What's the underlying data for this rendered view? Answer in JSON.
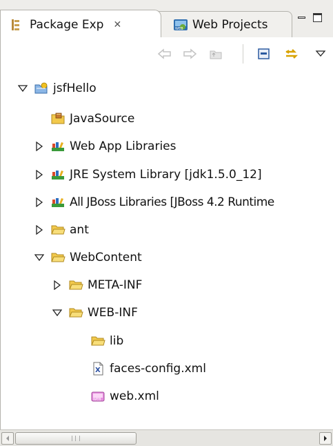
{
  "tabs": {
    "active": {
      "label": "Package Exp",
      "close_glyph": "✕"
    },
    "inactive": {
      "label": "Web Projects"
    }
  },
  "toolbar": {
    "buttons": [
      "back-arrow-icon",
      "forward-arrow-icon",
      "up-folder-icon",
      "collapse-all-icon",
      "link-with-editor-icon",
      "view-menu-icon"
    ]
  },
  "tree": {
    "items": [
      {
        "label": "jsfHello",
        "icon": "project-icon",
        "expanded": true
      },
      {
        "label": "JavaSource",
        "icon": "source-folder-icon",
        "expanded": null
      },
      {
        "label": "Web App Libraries",
        "icon": "library-icon",
        "expanded": false
      },
      {
        "label": "JRE System Library [jdk1.5.0_12]",
        "icon": "library-icon",
        "expanded": false
      },
      {
        "label": "All JBoss Libraries [JBoss 4.2 Runtime",
        "icon": "library-icon",
        "expanded": false
      },
      {
        "label": "ant",
        "icon": "folder-icon",
        "expanded": false
      },
      {
        "label": "WebContent",
        "icon": "folder-icon",
        "expanded": true
      },
      {
        "label": "META-INF",
        "icon": "folder-icon",
        "expanded": false
      },
      {
        "label": "WEB-INF",
        "icon": "folder-icon",
        "expanded": true
      },
      {
        "label": "lib",
        "icon": "folder-icon",
        "expanded": null
      },
      {
        "label": "faces-config.xml",
        "icon": "xml-file-icon",
        "expanded": null
      },
      {
        "label": "web.xml",
        "icon": "web-xml-icon",
        "expanded": null
      }
    ]
  },
  "colors": {
    "folder": "#f2c94c",
    "library": "#3a9a3a",
    "chrome": "#eeedea",
    "border": "#b4b3ad"
  }
}
